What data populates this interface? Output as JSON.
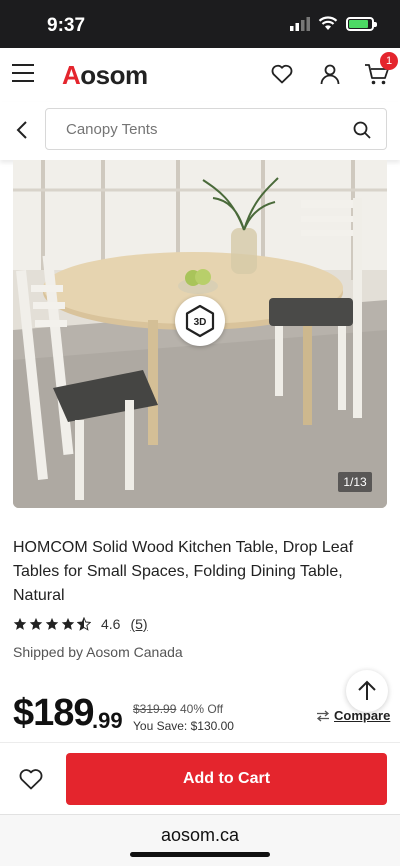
{
  "status": {
    "time": "9:37",
    "battery_level": 0.85,
    "battery_color": "#4cd964"
  },
  "header": {
    "logo_text": "Aosom",
    "brand_color": "#e4252d",
    "cart_count": "1"
  },
  "search": {
    "placeholder": "Canopy Tents"
  },
  "gallery": {
    "badge_label": "3D",
    "page_indicator": "1/13"
  },
  "product": {
    "title": "HOMCOM Solid Wood Kitchen Table, Drop Leaf Tables for Small Spaces, Folding Dining Table, Natural",
    "rating": "4.6",
    "rating_stars": 4.5,
    "review_count": "(5)",
    "shipped_by": "Shipped by Aosom Canada"
  },
  "price": {
    "dollars": "$189",
    "cents": ".99",
    "original": "$319.99",
    "discount": "40% Off",
    "savings": "You Save: $130.00"
  },
  "actions": {
    "compare_label": "Compare",
    "add_to_cart_label": "Add to Cart"
  },
  "browser": {
    "url": "aosom.ca"
  }
}
